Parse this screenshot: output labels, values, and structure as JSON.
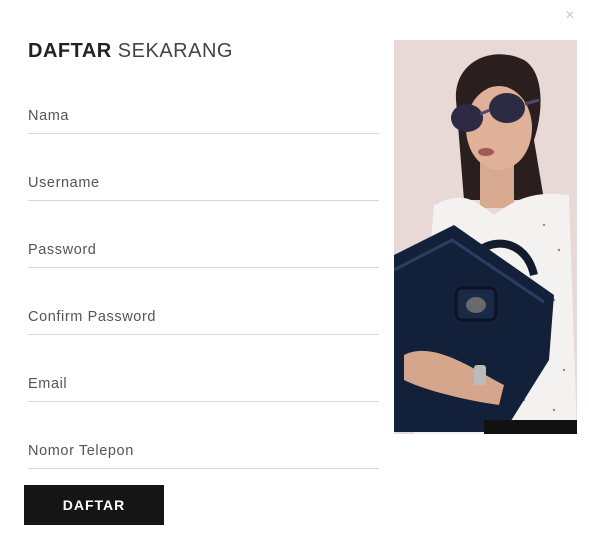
{
  "modal": {
    "close_glyph": "×",
    "title_bold": "DAFTAR",
    "title_light": "SEKARANG"
  },
  "form": {
    "fields": [
      {
        "placeholder": "Nama",
        "value": ""
      },
      {
        "placeholder": "Username",
        "value": ""
      },
      {
        "placeholder": "Password",
        "value": ""
      },
      {
        "placeholder": "Confirm Password",
        "value": ""
      },
      {
        "placeholder": "Email",
        "value": ""
      },
      {
        "placeholder": "Nomor Telepon",
        "value": ""
      }
    ],
    "submit_label": "DAFTAR"
  },
  "colors": {
    "button_bg": "#151515",
    "divider": "#d7d7d7",
    "photo_bg": "#e6d6d2"
  }
}
